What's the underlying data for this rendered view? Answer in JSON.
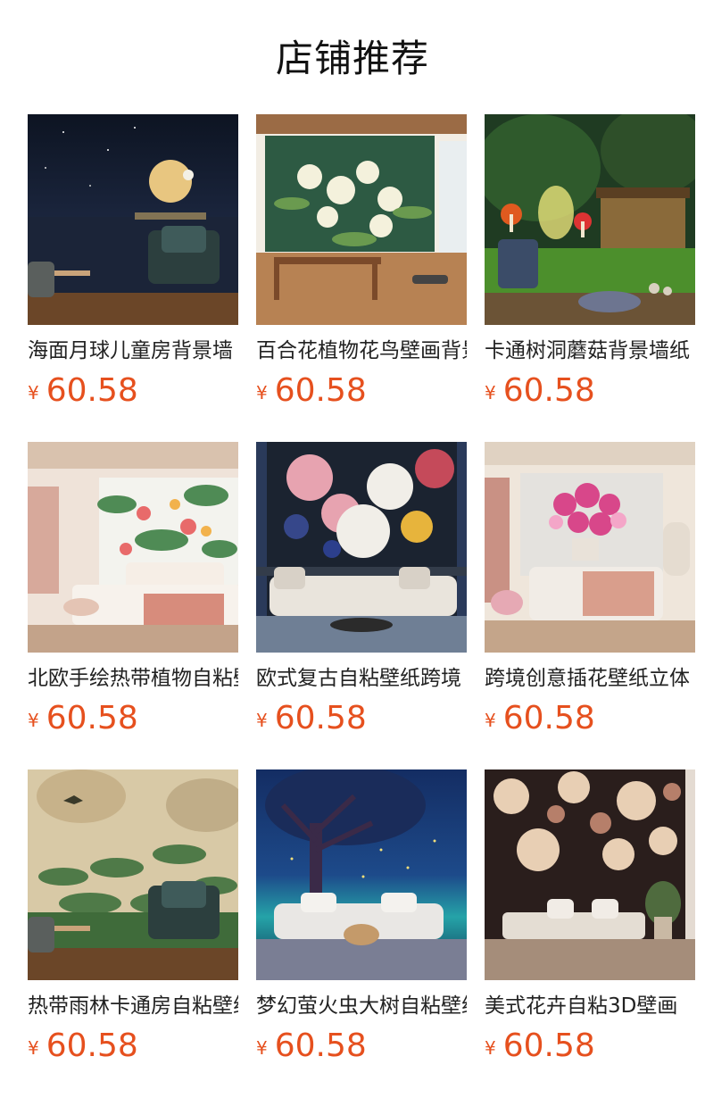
{
  "shop": {
    "title": "店铺推荐"
  },
  "currency_symbol": "¥",
  "products": [
    {
      "name": "海面月球儿童房背景墙",
      "price": "60.58",
      "image": "moon-sea-bedroom-mural"
    },
    {
      "name": "百合花植物花鸟壁画背景墙",
      "price": "60.58",
      "image": "lily-flower-mural"
    },
    {
      "name": "卡通树洞蘑菇背景墙纸",
      "price": "60.58",
      "image": "cartoon-tree-mushroom-mural"
    },
    {
      "name": "北欧手绘热带植物自粘壁纸",
      "price": "60.58",
      "image": "tropical-plant-bedroom-mural"
    },
    {
      "name": "欧式复古自粘壁纸跨境",
      "price": "60.58",
      "image": "vintage-peony-mural"
    },
    {
      "name": "跨境创意插花壁纸立体",
      "price": "60.58",
      "image": "pink-flower-vase-mural"
    },
    {
      "name": "热带雨林卡通房自粘壁纸",
      "price": "60.58",
      "image": "rainforest-mural"
    },
    {
      "name": "梦幻萤火虫大树自粘壁纸",
      "price": "60.58",
      "image": "firefly-tree-mural"
    },
    {
      "name": "美式花卉自粘3D壁画",
      "price": "60.58",
      "image": "floral-3d-mural"
    }
  ]
}
